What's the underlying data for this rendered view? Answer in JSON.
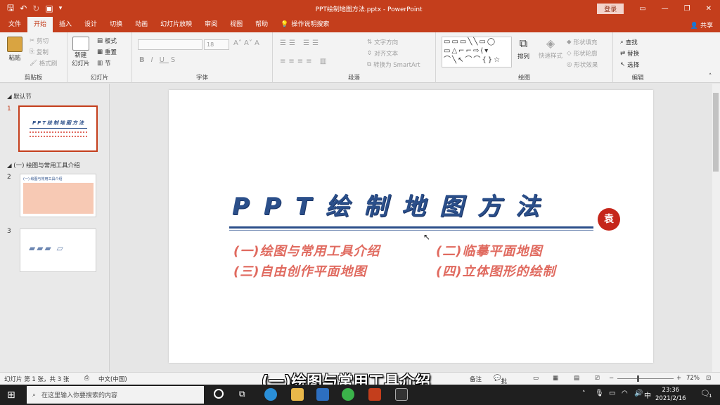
{
  "window": {
    "title": "PPT绘制地图方法.pptx - PowerPoint",
    "login": "登录",
    "share": "共享"
  },
  "tabs": [
    "文件",
    "开始",
    "插入",
    "设计",
    "切换",
    "动画",
    "幻灯片放映",
    "审阅",
    "视图",
    "帮助"
  ],
  "tell_me": "操作说明搜索",
  "ribbon": {
    "clipboard": {
      "paste": "粘贴",
      "cut": "剪切",
      "copy": "复制",
      "format_painter": "格式刷",
      "label": "剪贴板"
    },
    "slides": {
      "new_slide": "新建",
      "new_slide_line2": "幻灯片",
      "layout": "板式",
      "reset": "重置",
      "section": "节",
      "label": "幻灯片"
    },
    "font": {
      "size": "18",
      "label": "字体"
    },
    "paragraph": {
      "text_direction": "文字方向",
      "align_text": "对齐文本",
      "smartart": "转换为 SmartArt",
      "label": "段落"
    },
    "drawing": {
      "arrange": "排列",
      "quick_styles": "快速样式",
      "shape_fill": "形状填充",
      "shape_outline": "形状轮廓",
      "shape_effects": "形状效果",
      "label": "绘图",
      "shapes_glyphs": "▭▭▭╲╲▭◯\n▭△⌐⌐⇨⟨▾\n⌒╲↖⌒⌒{}☆"
    },
    "editing": {
      "find": "查找",
      "replace": "替换",
      "select": "选择",
      "label": "编辑"
    }
  },
  "sidebar": {
    "section_default": "默认节",
    "section_2": "(一) 绘图与常用工具介绍",
    "slides": [
      {
        "number": "1",
        "title": "PPT绘制地图方法"
      },
      {
        "number": "2",
        "title": "(一) 绘图与常用工具介绍"
      },
      {
        "number": "3",
        "title": ""
      }
    ]
  },
  "slide": {
    "title": "PPT绘制地图方法",
    "seal": "袁",
    "items": [
      "(一)绘图与常用工具介绍",
      "(二)临摹平面地图",
      "(三)自由创作平面地图",
      "(四)立体图形的绘制"
    ]
  },
  "status": {
    "slide_info": "幻灯片 第 1 张，共 3 张",
    "language": "中文(中国)",
    "notes": "备注",
    "comments": "批注",
    "zoom": "72%"
  },
  "caption": "(一)绘图与常用工具介绍",
  "taskbar": {
    "search_placeholder": "在这里输入你要搜索的内容",
    "ime": "中",
    "time": "23:36",
    "date": "2021/2/16",
    "notification_count": "1"
  },
  "colors": {
    "accent": "#c43e1c",
    "title_blue": "#2b4f8a",
    "item_red": "#e06a5f"
  }
}
